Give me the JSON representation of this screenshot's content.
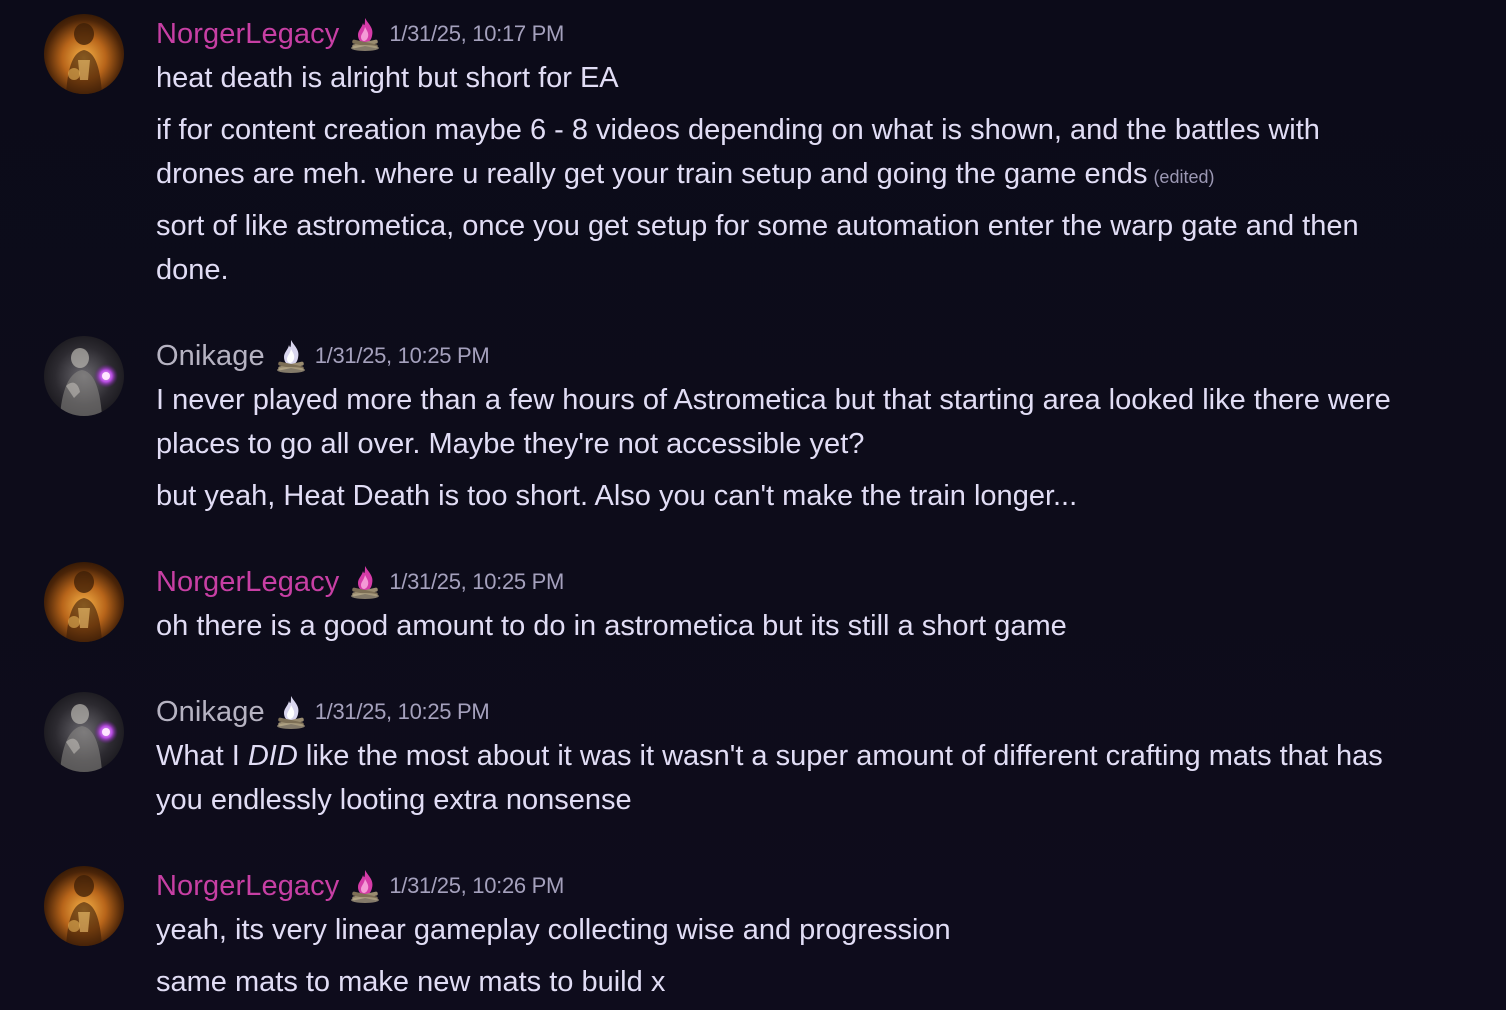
{
  "colors": {
    "background": "#0d0c1a",
    "norger_name": "#c73fa4",
    "onikage_name": "#b6b3c2",
    "text": "#e1ddf5",
    "timestamp": "#a5a1bd"
  },
  "messages": [
    {
      "author": "NorgerLegacy",
      "role_icon": "campfire-pink-icon",
      "timestamp": "1/31/25, 10:17 PM",
      "lines": [
        "heat death is alright but short for EA",
        "if  for content creation maybe 6 - 8 videos depending on what is shown, and the battles with",
        "drones are meh. where u really get your train setup and going the game ends",
        "sort of like astrometica, once you get setup for some automation enter the warp gate and then",
        "done."
      ],
      "edited_label": "(edited)"
    },
    {
      "author": "Onikage",
      "role_icon": "campfire-white-icon",
      "timestamp": "1/31/25, 10:25 PM",
      "lines": [
        "I never played more than a few hours of Astrometica but that starting area looked like there were",
        "places to go all over. Maybe they're not accessible yet?",
        "but yeah, Heat Death is too short. Also you can't make the train longer..."
      ]
    },
    {
      "author": "NorgerLegacy",
      "role_icon": "campfire-pink-icon",
      "timestamp": "1/31/25, 10:25 PM",
      "lines": [
        "oh there is a good amount to do in astrometica but its still a short game"
      ]
    },
    {
      "author": "Onikage",
      "role_icon": "campfire-white-icon",
      "timestamp": "1/31/25, 10:25 PM",
      "lines_parts": {
        "pre": "What I ",
        "em": "DID",
        "post": " like the most about it was it wasn't a super amount of different crafting mats that has"
      },
      "lines": [
        "you endlessly looting extra nonsense"
      ]
    },
    {
      "author": "NorgerLegacy",
      "role_icon": "campfire-pink-icon",
      "timestamp": "1/31/25, 10:26 PM",
      "lines": [
        "yeah, its very linear gameplay collecting wise and progression",
        "same mats to make new mats to build x"
      ]
    }
  ]
}
